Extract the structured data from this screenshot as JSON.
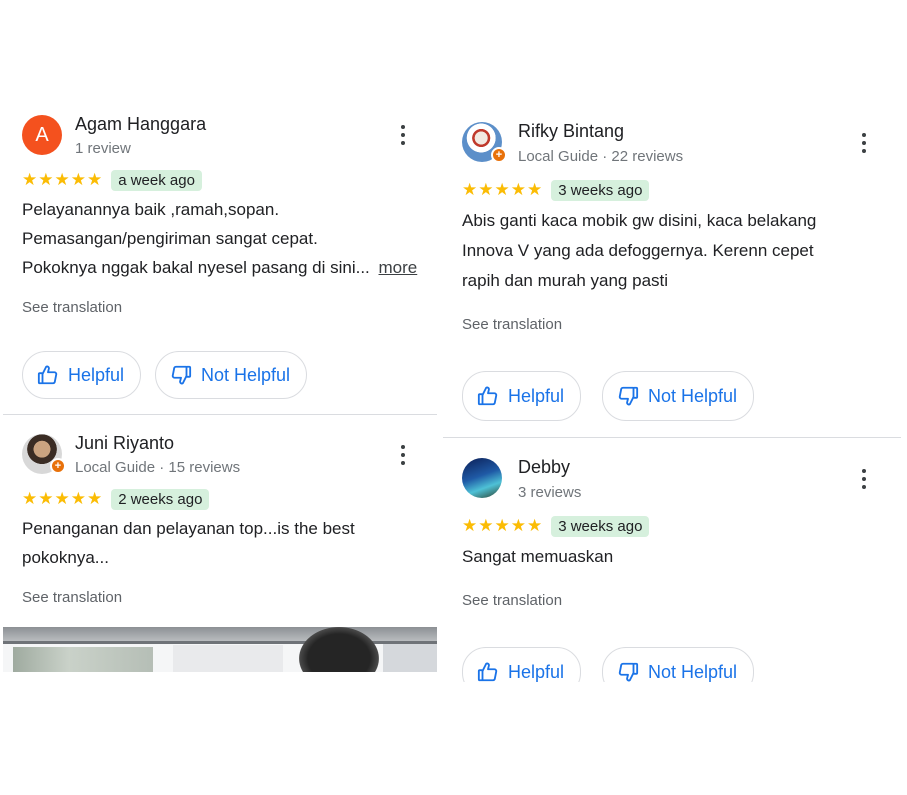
{
  "reviews_left": [
    {
      "avatar_letter": "A",
      "name": "Agam Hanggara",
      "meta": "1 review",
      "stars": "★★★★★",
      "date": "a week ago",
      "text_lines": [
        "Pelayanannya baik ,ramah,sopan.",
        "Pemasangan/pengiriman sangat cepat.",
        "Pokoknya nggak bakal nyesel pasang di sini..."
      ],
      "more_label": "more",
      "see_translation": "See translation",
      "helpful_label": "Helpful",
      "not_helpful_label": "Not Helpful"
    },
    {
      "name": "Juni Riyanto",
      "meta": "Local Guide · 15 reviews",
      "stars": "★★★★★",
      "date": "2 weeks ago",
      "text_lines": [
        "Penanganan dan pelayanan top...is the best",
        "pokoknya..."
      ],
      "see_translation": "See translation"
    }
  ],
  "reviews_right": [
    {
      "name": "Rifky Bintang",
      "meta": "Local Guide · 22 reviews",
      "stars": "★★★★★",
      "date": "3 weeks ago",
      "text_lines": [
        "Abis ganti kaca mobik gw disini, kaca belakang",
        "Innova V yang ada defoggernya. Kerenn cepet",
        "rapih dan murah yang pasti"
      ],
      "see_translation": "See translation",
      "helpful_label": "Helpful",
      "not_helpful_label": "Not Helpful"
    },
    {
      "name": "Debby",
      "meta": "3 reviews",
      "stars": "★★★★★",
      "date": "3 weeks ago",
      "text_lines": [
        "Sangat memuaskan"
      ],
      "see_translation": "See translation",
      "helpful_label": "Helpful",
      "not_helpful_label": "Not Helpful"
    }
  ],
  "icons": {
    "more_options": "more-vert-icon",
    "helpful": "thumbs-up-icon",
    "not_helpful": "thumbs-down-icon",
    "local_guide": "local-guide-badge-icon"
  },
  "colors": {
    "star": "#fbbc04",
    "date_badge_bg": "#d6f0dd",
    "button_text": "#1a73e8",
    "avatar_letter_bg": "#f4511e",
    "guide_badge": "#e8710a"
  }
}
